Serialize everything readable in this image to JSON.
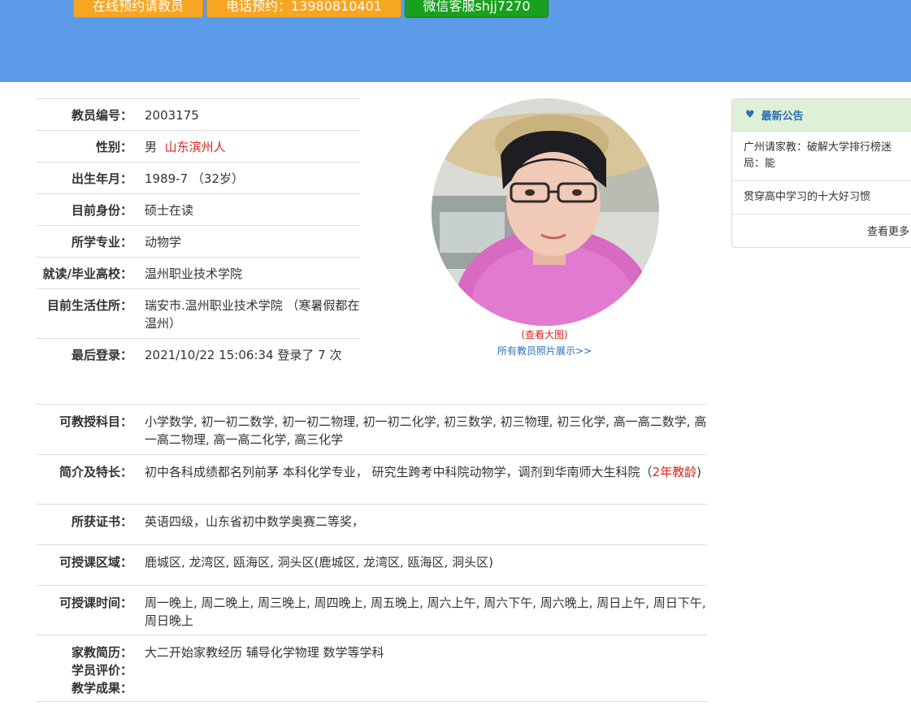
{
  "banner": {
    "buttons": {
      "online": "在线预约请教员",
      "phone": "电话预约：13980810401",
      "wechat": "微信客服shjj7270"
    }
  },
  "profile": {
    "rows": [
      {
        "label": "教员编号：",
        "value": "2003175"
      },
      {
        "label": "性别：",
        "value": "男",
        "extra": "山东滨州人"
      },
      {
        "label": "出生年月：",
        "value": "1989-7 （32岁）"
      },
      {
        "label": "目前身份：",
        "value": "硕士在读"
      },
      {
        "label": "所学专业：",
        "value": "动物学"
      },
      {
        "label": "就读/毕业高校：",
        "value": "温州职业技术学院"
      },
      {
        "label": "目前生活住所：",
        "value": "瑞安市.温州职业技术学院 （寒暑假都在温州）"
      },
      {
        "label": "最后登录：",
        "value": "2021/10/22 15:06:34 登录了 7 次"
      }
    ]
  },
  "photo": {
    "view_large": "(查看大图)",
    "all_photos": "所有教员照片展示>>"
  },
  "details": {
    "subjects": {
      "label": "可教授科目：",
      "value": "小学数学, 初一初二数学, 初一初二物理, 初一初二化学, 初三数学, 初三物理, 初三化学, 高一高二数学, 高一高二物理, 高一高二化学, 高三化学"
    },
    "intro": {
      "label": "简介及特长：",
      "value": "初中各科成绩都名列前茅 本科化学专业， 研究生跨考中科院动物学，调剂到华南师大生科院",
      "years": "2年教龄",
      "open": "（",
      "close": ")"
    },
    "certs": {
      "label": "所获证书：",
      "value": "英语四级，山东省初中数学奥赛二等奖，"
    },
    "areas": {
      "label": "可授课区域：",
      "value": "鹿城区, 龙湾区, 瓯海区, 洞头区(鹿城区, 龙湾区, 瓯海区, 洞头区)"
    },
    "times": {
      "label": "可授课时间：",
      "value": "周一晚上, 周二晚上, 周三晚上, 周四晚上, 周五晚上, 周六上午, 周六下午, 周六晚上, 周日上午, 周日下午, 周日晚上"
    },
    "history": {
      "label": "家教简历：",
      "value": "大二开始家教经历 辅导化学物理 数学等学科"
    },
    "review": {
      "label": "学员评价："
    },
    "results": {
      "label": "教学成果："
    }
  },
  "notice": {
    "title": "最新公告",
    "items": [
      "广州请家教：破解大学排行榜迷局：能",
      "贯穿高中学习的十大好习惯"
    ],
    "more": "查看更多"
  },
  "colors": {
    "banner": "#5b9be8",
    "orange_button": "#f6a623",
    "green_button": "#19a01e",
    "accent_red": "#d9261c",
    "link_blue": "#2a6fb5"
  }
}
